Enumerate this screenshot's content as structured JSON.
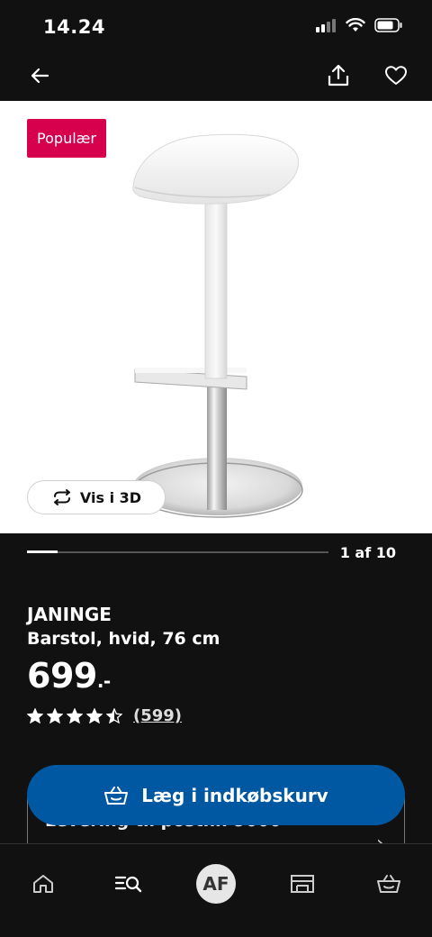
{
  "status_bar": {
    "time": "14.24"
  },
  "product": {
    "badge": "Populær",
    "view_3d_label": "Vis i 3D",
    "gallery": {
      "current": 1,
      "total": 10,
      "label": "1 af 10"
    },
    "name": "JANINGE",
    "description": "Barstol, hvid, 76 cm",
    "price": "699",
    "price_suffix": ".-",
    "rating": {
      "stars": 4.5,
      "max": 5,
      "count_label": "(599)"
    }
  },
  "delivery": {
    "text": "Levering til postnr. 9000"
  },
  "cart_button": {
    "label": "Læg i indkøbskurv"
  },
  "bottom_nav": {
    "avatar_initials": "AF"
  },
  "colors": {
    "accent_blue": "#0058a3",
    "badge_pink": "#d6004d",
    "background": "#111111"
  }
}
